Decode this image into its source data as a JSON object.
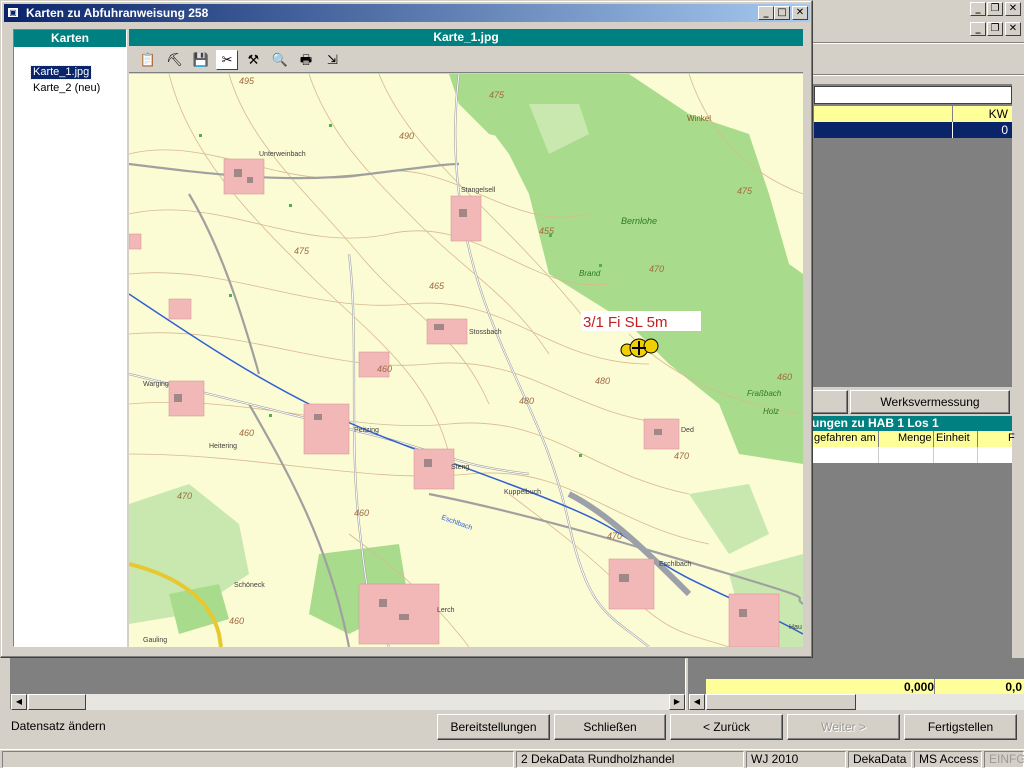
{
  "main": {
    "kw_header": "KW",
    "kw_value": "0",
    "werksvermessung_label": "Werksvermessung",
    "section_title": "ungen zu HAB 1 Los 1",
    "columns": [
      "gefahren am",
      "Menge",
      "Einheit",
      "F"
    ],
    "total_value1": "0,000",
    "total_value2": "0,0",
    "status_text": "Datensatz ändern"
  },
  "buttons": {
    "bereitstellungen": "Bereitstellungen",
    "schliessen": "Schließen",
    "zurueck": "< Zurück",
    "weiter": "Weiter >",
    "fertigstellen": "Fertigstellen"
  },
  "statusbar": {
    "app": "2 DekaData Rundholzhandel",
    "year": "WJ 2010",
    "vendor": "DekaData",
    "db": "MS Access",
    "mode": "EINFG"
  },
  "dialog": {
    "title": "Karten zu Abfuhranweisung 258",
    "list_header": "Karten",
    "map_header": "Karte_1.jpg",
    "items": [
      "Karte_1.jpg",
      "Karte_2 (neu)"
    ],
    "annotation": "3/1  Fi SL 5m",
    "map_labels": {
      "winkel": "Winkel",
      "bernlohe": "Bernlohe",
      "brand": "Brand",
      "frassbach": "Fraßbach",
      "holz": "Holz",
      "unterweinbach": "Unterweinbach",
      "stangelsell": "Stangelsell",
      "stossbach": "Stossbach",
      "warging": "Warging",
      "peitzing": "Peitzing",
      "heitering": "Heitering",
      "steng": "Steng",
      "kuppelbuch": "Kuppelbuch",
      "eschlbach": "Eschlbach",
      "eschlbach_river": "Eschlbach",
      "schoeneck": "Schöneck",
      "lerch": "Lerch",
      "gauling": "Gauling",
      "ded": "Ded",
      "hau": "Hau"
    },
    "contour_labels": [
      "495",
      "490",
      "475",
      "465",
      "455",
      "470",
      "460",
      "475",
      "470",
      "460",
      "460",
      "460",
      "470",
      "480",
      "480",
      "470",
      "460",
      "475"
    ]
  }
}
